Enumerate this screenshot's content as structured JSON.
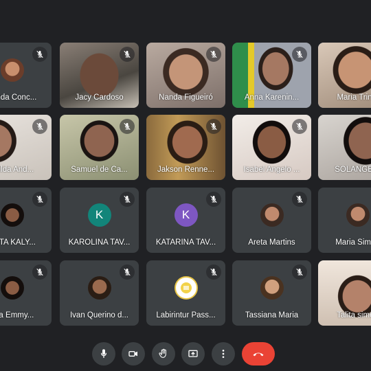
{
  "meeting": {
    "colors": {
      "background": "#202124",
      "tile": "#3c4043",
      "active_border": "#8ab4f8",
      "end_call": "#ea4335"
    }
  },
  "participants": [
    {
      "name": "nanda Conc...",
      "kind": "avatar",
      "muted": true
    },
    {
      "name": "Jacy Cardoso",
      "kind": "video",
      "muted": true
    },
    {
      "name": "Nanda Figueiró",
      "kind": "video",
      "muted": true
    },
    {
      "name": "Anna Karenin...",
      "kind": "video",
      "muted": true
    },
    {
      "name": "Maria Trinid",
      "kind": "video",
      "muted": false,
      "active": true
    },
    {
      "name": "rinilda And...",
      "kind": "video",
      "muted": true
    },
    {
      "name": "Samuel de Ca...",
      "kind": "video",
      "muted": true
    },
    {
      "name": "Jakson Renne...",
      "kind": "video",
      "muted": true
    },
    {
      "name": "Isabel Angelo ...",
      "kind": "video",
      "muted": true
    },
    {
      "name": "SOLANGE V",
      "kind": "video",
      "muted": false
    },
    {
      "name": "ERTA KALY...",
      "kind": "avatar",
      "muted": true
    },
    {
      "name": "KAROLINA TAV...",
      "kind": "letter",
      "letter": "K",
      "letter_color": "#12857a",
      "muted": true
    },
    {
      "name": "KATARINA TAV...",
      "kind": "letter",
      "letter": "K",
      "letter_color": "#7e57c2",
      "muted": true
    },
    {
      "name": "Areta Martins",
      "kind": "avatar",
      "muted": true
    },
    {
      "name": "Maria Simon",
      "kind": "avatar",
      "muted": true
    },
    {
      "name": "nda Emmy...",
      "kind": "avatar",
      "muted": true
    },
    {
      "name": "Ivan Querino d...",
      "kind": "avatar",
      "muted": true
    },
    {
      "name": "Labirintur Pass...",
      "kind": "logo",
      "muted": true
    },
    {
      "name": "Tassiana Maria",
      "kind": "avatar",
      "muted": true
    },
    {
      "name": "Talita simon",
      "kind": "video",
      "muted": false
    }
  ],
  "controls": [
    {
      "id": "mic",
      "icon": "microphone-icon"
    },
    {
      "id": "camera",
      "icon": "camera-icon"
    },
    {
      "id": "raise-hand",
      "icon": "hand-icon"
    },
    {
      "id": "present",
      "icon": "present-screen-icon"
    },
    {
      "id": "more",
      "icon": "more-options-icon"
    },
    {
      "id": "end-call",
      "icon": "hang-up-icon"
    }
  ]
}
